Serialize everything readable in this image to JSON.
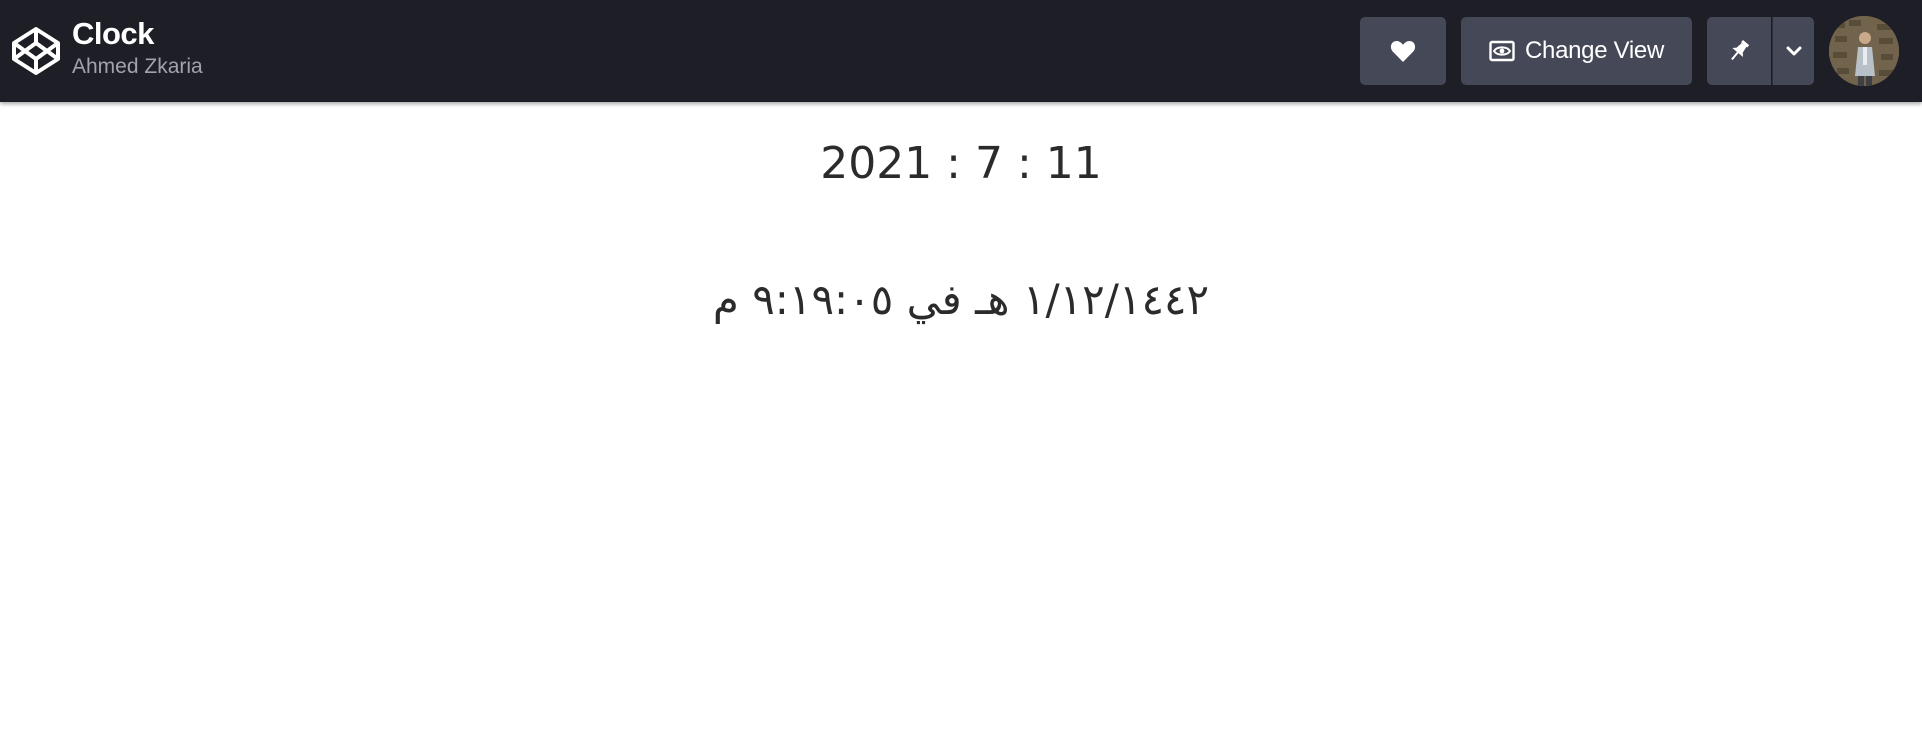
{
  "header": {
    "title": "Clock",
    "author": "Ahmed Zkaria",
    "change_view_label": "Change View",
    "icons": {
      "logo": "codepen-logo-icon",
      "heart": "heart-icon",
      "view": "eye-icon",
      "pin": "pin-icon",
      "caret": "chevron-down-icon"
    }
  },
  "clock": {
    "gregorian_date": "2021 : 7 : 11",
    "hijri_datetime": "١/١٢/١٤٤٢ هـ في ٩:١٩:٠٥ م"
  },
  "colors": {
    "header_bg": "#1e1f26",
    "button_bg": "#444857",
    "author_text": "#a0a3ae",
    "body_text": "#2b2b2b"
  }
}
